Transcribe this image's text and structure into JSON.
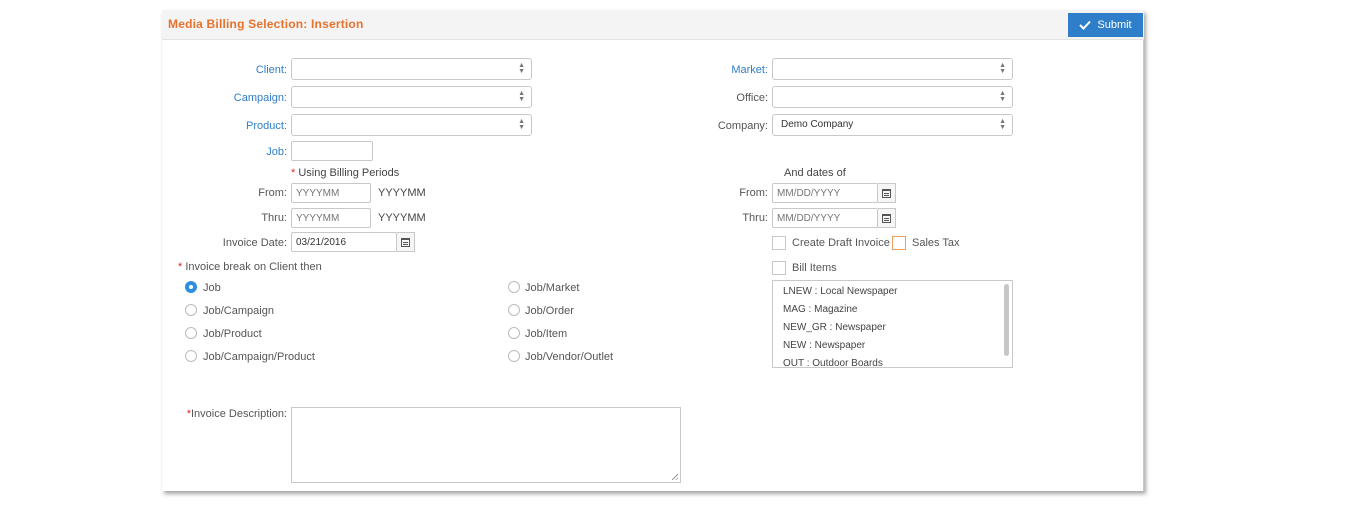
{
  "header": {
    "title": "Media Billing Selection: Insertion",
    "submit_label": "Submit"
  },
  "left": {
    "client_label": "Client:",
    "client_value": "",
    "campaign_label": "Campaign:",
    "campaign_value": "",
    "product_label": "Product:",
    "product_value": "",
    "job_label": "Job:",
    "job_value": "",
    "billing_periods_note": "Using Billing Periods",
    "from_label": "From:",
    "from_placeholder": "YYYYMM",
    "from_hint": "YYYYMM",
    "thru_label": "Thru:",
    "thru_placeholder": "YYYYMM",
    "thru_hint": "YYYYMM",
    "invoice_date_label": "Invoice Date:",
    "invoice_date_value": "03/21/2016"
  },
  "right": {
    "market_label": "Market:",
    "market_value": "",
    "office_label": "Office:",
    "office_value": "",
    "company_label": "Company:",
    "company_value": "Demo Company",
    "dates_note": "And dates of",
    "from_label": "From:",
    "from_placeholder": "MM/DD/YYYY",
    "thru_label": "Thru:",
    "thru_placeholder": "MM/DD/YYYY",
    "create_draft_label": "Create Draft Invoice",
    "create_draft_checked": false,
    "sales_tax_label": "Sales Tax",
    "sales_tax_checked": false,
    "bill_items_label": "Bill Items",
    "bill_items_checked": false,
    "bill_items_list": [
      "LNEW : Local Newspaper",
      "MAG : Magazine",
      "NEW_GR : Newspaper",
      "NEW : Newspaper",
      "OUT : Outdoor Boards"
    ]
  },
  "invoice_break": {
    "label": "Invoice break on Client then",
    "selected": "Job",
    "options_col1": [
      "Job",
      "Job/Campaign",
      "Job/Product",
      "Job/Campaign/Product"
    ],
    "options_col2": [
      "Job/Market",
      "Job/Order",
      "Job/Item",
      "Job/Vendor/Outlet"
    ]
  },
  "invoice_description": {
    "label": "Invoice Description:",
    "value": ""
  },
  "colors": {
    "accent": "#2f7ec9",
    "title": "#e8722c",
    "required": "#d9281e"
  }
}
